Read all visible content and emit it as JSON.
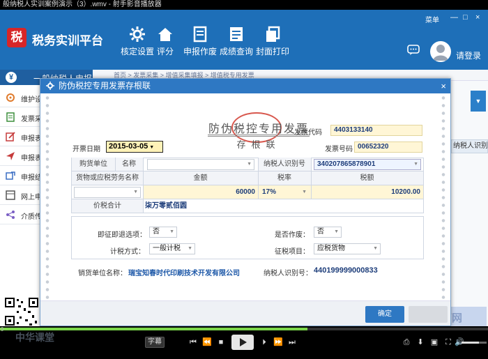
{
  "player": {
    "window_title": "般纳税人实训案例演示（3）.wmv - 射手影音播放器",
    "subtitle_button": "字幕",
    "progress_fraction": 0.63,
    "volume_fraction": 0.7,
    "time_label": "9",
    "watermark_text": "中华课堂"
  },
  "app": {
    "name": "税务实训平台",
    "logo_char": "税",
    "menu_label": "菜单",
    "nav": [
      {
        "label": "核定设置",
        "icon": "gear-icon"
      },
      {
        "label": "评分",
        "icon": "home-icon"
      },
      {
        "label": "申报作废",
        "icon": "printer-icon"
      },
      {
        "label": "成绩查询",
        "icon": "document-icon"
      },
      {
        "label": "封面打印",
        "icon": "copy-icon"
      }
    ],
    "login_label": "请登录"
  },
  "sidebar": {
    "header": "一般纳税人申报",
    "items": [
      {
        "label": "维护设置",
        "icon": "settings-icon"
      },
      {
        "label": "发票采集",
        "icon": "document-icon"
      },
      {
        "label": "申报表填写",
        "icon": "edit-icon"
      },
      {
        "label": "申报表发送",
        "icon": "send-icon"
      },
      {
        "label": "申报结果",
        "icon": "result-icon"
      },
      {
        "label": "网上申报",
        "icon": "window-icon"
      },
      {
        "label": "介质传送",
        "icon": "share-icon"
      }
    ]
  },
  "background": {
    "breadcrumb": "首页 > 发票采集 > 增值采集填报 > 增值税专用发票",
    "table_header": "纳税人识别"
  },
  "dialog": {
    "title": "防伪税控专用发票存根联",
    "invoice_title": "防伪税控专用发票",
    "invoice_subtitle": "存根联",
    "invoice_code_label": "发票代码",
    "invoice_code": "4403133140",
    "invoice_number_label": "发票号码",
    "invoice_number": "00652320",
    "date_label": "开票日期",
    "date_value": "2015-03-05",
    "buyer_unit_label": "购货单位",
    "name_label": "名称",
    "buyer_name": "",
    "buyer_tax_id_label": "纳税人识别号",
    "buyer_tax_id": "340207865878901",
    "goods_name_label": "货物或应税劳务名称",
    "amount_label": "金额",
    "tax_rate_label": "税率",
    "tax_amount_label": "税额",
    "goods_name": "",
    "amount": "60000",
    "tax_rate": "17%",
    "tax_amount": "10200.00",
    "total_label": "价税合计",
    "total_in_words": "柒万零贰佰圆",
    "immediate_refund_label": "即征即退选项：",
    "immediate_refund_value": "否",
    "void_label": "是否作废：",
    "void_value": "否",
    "tax_method_label": "计税方式：",
    "tax_method_value": "一般计税",
    "levy_item_label": "征税项目：",
    "levy_item_value": "应税货物",
    "seller_name_label": "销货单位名称：",
    "seller_name": "瑞宝知春时代印刷技术开发有限公司",
    "seller_tax_id_label": "纳税人识别号：",
    "seller_tax_id": "440199999000833",
    "confirm_button": "确定",
    "close_glyph": "×"
  },
  "colors": {
    "header_blue": "#1e6fb8",
    "dialog_title_blue": "#2e78c3",
    "field_yellow": "#fff6d6",
    "seal_red": "#d8584e",
    "logo_red": "#d72628",
    "progress_green": "#7bd64a"
  }
}
